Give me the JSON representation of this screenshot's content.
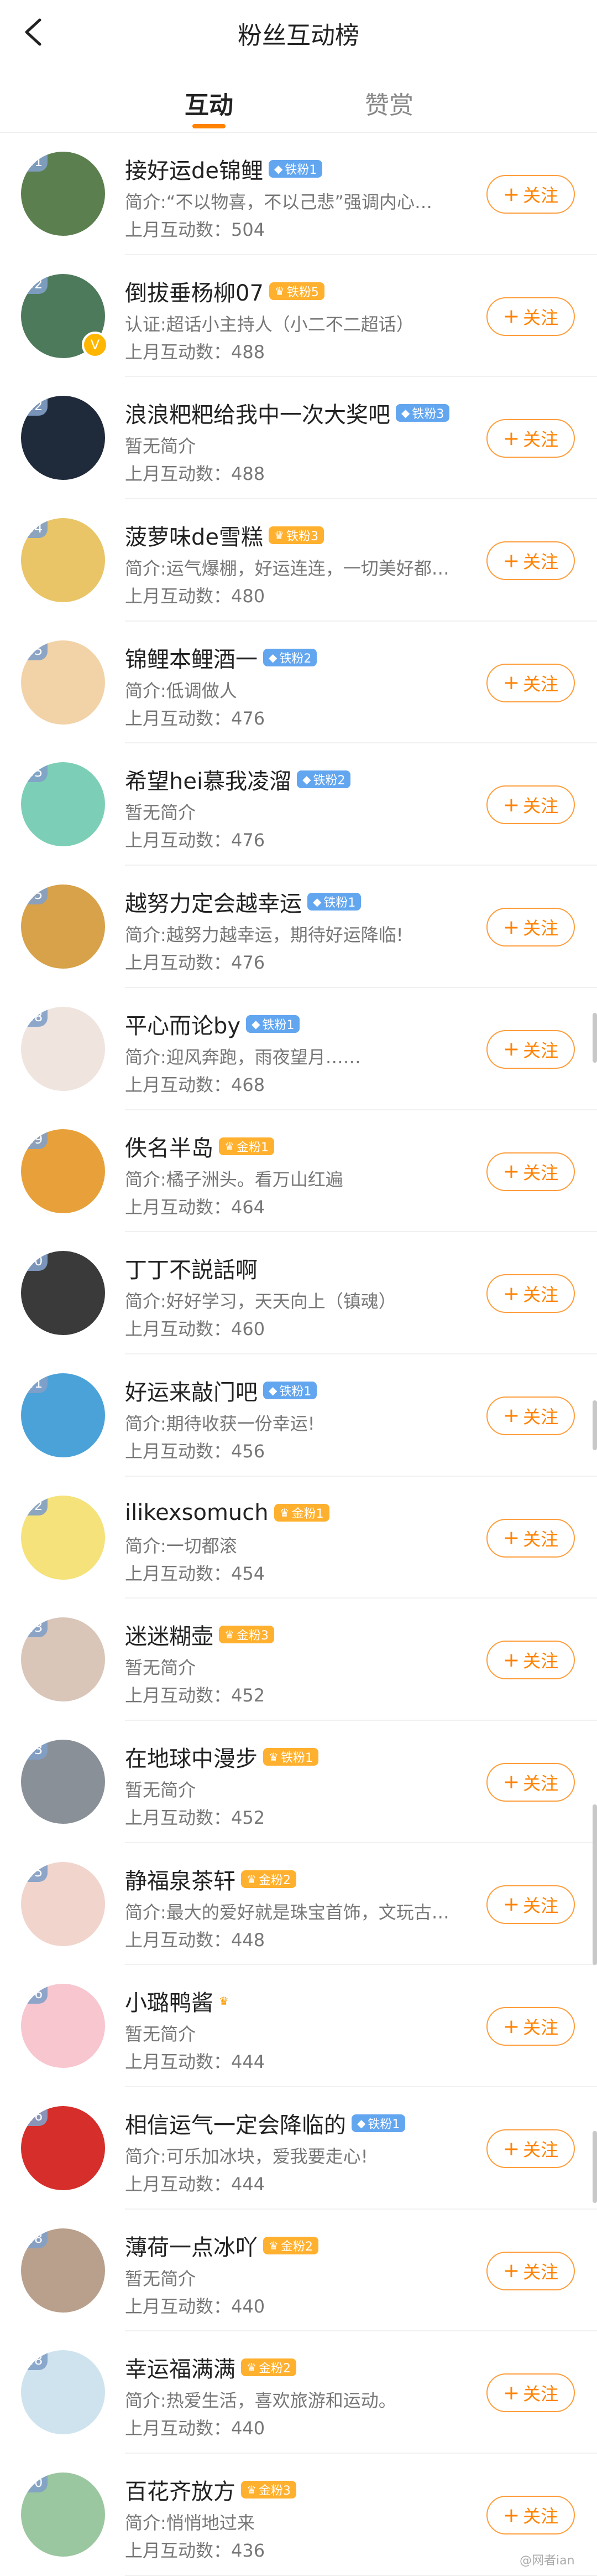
{
  "header": {
    "title": "粉丝互动榜"
  },
  "tabs": [
    {
      "label": "互动",
      "active": true
    },
    {
      "label": "赞赏",
      "active": false
    }
  ],
  "follow_label": "关注",
  "watermark": "@网者ian",
  "rows": [
    {
      "rank": "31",
      "name": "接好运de锦鲤",
      "badge": "铁粉1",
      "badge_type": "blue",
      "desc": "简介:“不以物喜，不以己悲”强调内心…",
      "stat": "上月互动数：504",
      "avatar_color": "#5b7f4e"
    },
    {
      "rank": "32",
      "name": "倒拔垂杨柳07",
      "badge": "铁粉5",
      "badge_type": "gold",
      "desc": "认证:超话小主持人（小二不二超话）",
      "stat": "上月互动数：488",
      "avatar_color": "#4e7a5c",
      "verified": true
    },
    {
      "rank": "32",
      "name": "浪浪粑粑给我中一次大奖吧",
      "badge": "铁粉3",
      "badge_type": "blue",
      "desc": "暂无简介",
      "stat": "上月互动数：488",
      "avatar_color": "#1f2a3a"
    },
    {
      "rank": "34",
      "name": "菠萝味de雪糕",
      "badge": "铁粉3",
      "badge_type": "gold",
      "desc": "简介:运气爆棚，好运连连，一切美好都…",
      "stat": "上月互动数：480",
      "avatar_color": "#e9c567"
    },
    {
      "rank": "35",
      "name": "锦鲤本鲤酒一",
      "badge": "铁粉2",
      "badge_type": "blue",
      "desc": "简介:低调做人",
      "stat": "上月互动数：476",
      "avatar_color": "#f2d3a8"
    },
    {
      "rank": "35",
      "name": "希望hei慕我凌溜",
      "badge": "铁粉2",
      "badge_type": "blue",
      "desc": "暂无简介",
      "stat": "上月互动数：476",
      "avatar_color": "#7ccfb6"
    },
    {
      "rank": "35",
      "name": "越努力定会越幸运",
      "badge": "铁粉1",
      "badge_type": "blue",
      "desc": "简介:越努力越幸运，期待好运降临!",
      "stat": "上月互动数：476",
      "avatar_color": "#d8a24a"
    },
    {
      "rank": "38",
      "name": "平心而论by",
      "badge": "铁粉1",
      "badge_type": "blue",
      "desc": "简介:迎风奔跑，雨夜望月……",
      "stat": "上月互动数：468",
      "avatar_color": "#efe4de"
    },
    {
      "rank": "39",
      "name": "佚名半岛",
      "badge": "金粉1",
      "badge_type": "gold",
      "desc": "简介:橘子洲头。看万山红遍",
      "stat": "上月互动数：464",
      "avatar_color": "#e8a13a"
    },
    {
      "rank": "40",
      "name": "丁丁不説話啊",
      "badge": "",
      "badge_type": "",
      "desc": "简介:好好学习，天天向上（镇魂）",
      "stat": "上月互动数：460",
      "avatar_color": "#3a3a3a"
    },
    {
      "rank": "41",
      "name": "好运来敲门吧",
      "badge": "铁粉1",
      "badge_type": "blue",
      "desc": "简介:期待收获一份幸运!",
      "stat": "上月互动数：456",
      "avatar_color": "#4aa2d8"
    },
    {
      "rank": "42",
      "name": "ilikexsomuch",
      "badge": "金粉1",
      "badge_type": "gold",
      "desc": "简介:一切都滚",
      "stat": "上月互动数：454",
      "avatar_color": "#f5e27a"
    },
    {
      "rank": "43",
      "name": "迷迷糊壶",
      "badge": "金粉3",
      "badge_type": "gold",
      "desc": "暂无简介",
      "stat": "上月互动数：452",
      "avatar_color": "#d9c6b8"
    },
    {
      "rank": "43",
      "name": "在地球中漫步",
      "badge": "铁粉1",
      "badge_type": "gold",
      "desc": "暂无简介",
      "stat": "上月互动数：452",
      "avatar_color": "#8a9098"
    },
    {
      "rank": "45",
      "name": "静福泉茶轩",
      "badge": "金粉2",
      "badge_type": "gold",
      "desc": "简介:最大的爱好就是珠宝首饰，文玩古…",
      "stat": "上月互动数：448",
      "avatar_color": "#f1d4cc"
    },
    {
      "rank": "46",
      "name": "小璐鸭酱",
      "badge": "",
      "badge_type": "gold-only",
      "desc": "暂无简介",
      "stat": "上月互动数：444",
      "avatar_color": "#f7c6cf"
    },
    {
      "rank": "46",
      "name": "相信运气一定会降临的",
      "badge": "铁粉1",
      "badge_type": "blue",
      "desc": "简介:可乐加冰块，爱我要走心!",
      "stat": "上月互动数：444",
      "avatar_color": "#d62e2a"
    },
    {
      "rank": "48",
      "name": "薄荷一点冰吖",
      "badge": "金粉2",
      "badge_type": "gold",
      "desc": "暂无简介",
      "stat": "上月互动数：440",
      "avatar_color": "#b9a08c"
    },
    {
      "rank": "48",
      "name": "幸运福满满",
      "badge": "金粉2",
      "badge_type": "gold",
      "desc": "简介:热爱生活，喜欢旅游和运动。",
      "stat": "上月互动数：440",
      "avatar_color": "#cfe3ef"
    },
    {
      "rank": "50",
      "name": "百花齐放方",
      "badge": "金粉3",
      "badge_type": "gold",
      "desc": "简介:悄悄地过来",
      "stat": "上月互动数：436",
      "avatar_color": "#9bc7a0"
    }
  ]
}
